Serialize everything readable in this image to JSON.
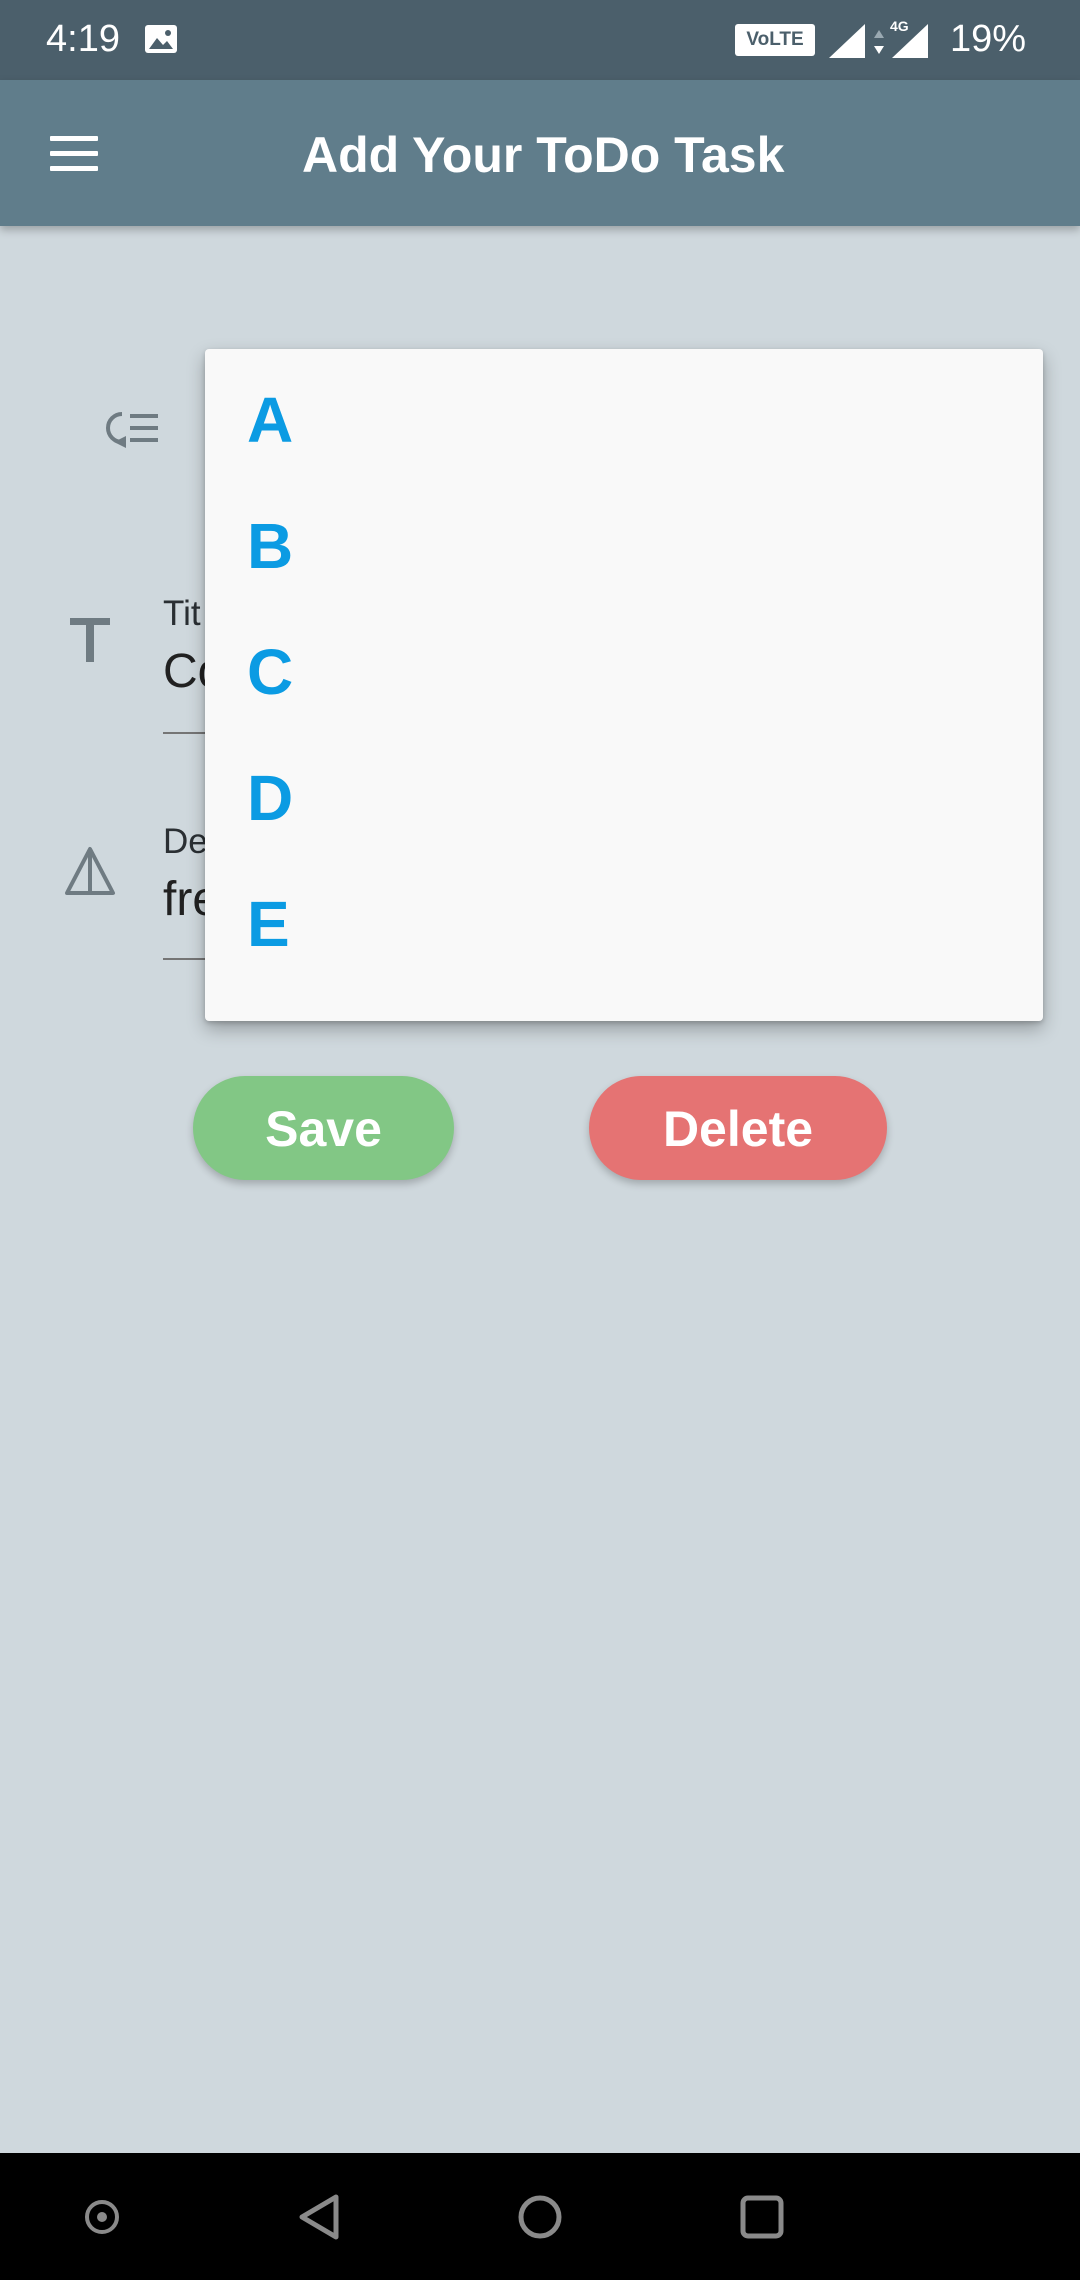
{
  "status_bar": {
    "time": "4:19",
    "volte": "VoLTE",
    "network": "4G",
    "battery": "19%",
    "icons": [
      "image-icon",
      "signal-icon",
      "data-arrows-icon",
      "signal-4g-icon"
    ]
  },
  "app_bar": {
    "menu_icon": "menu-icon",
    "title": "Add Your ToDo Task"
  },
  "form": {
    "priority_icon": "priority-icon",
    "title_field": {
      "icon": "text-title-icon",
      "label": "Tit",
      "value": "Co"
    },
    "description_field": {
      "icon": "description-icon",
      "label": "De",
      "value": "fre"
    }
  },
  "buttons": {
    "save": "Save",
    "delete": "Delete"
  },
  "dropdown": {
    "items": [
      "A",
      "B",
      "C",
      "D",
      "E"
    ]
  },
  "colors": {
    "status_bar": "#4b5f6b",
    "app_bar": "#607d8b",
    "background": "#cfd8dd",
    "save_button": "#82c785",
    "delete_button": "#e57373",
    "dropdown_text": "#0b9be3"
  },
  "nav_bar": {
    "icons": [
      "overview-dot-icon",
      "back-icon",
      "home-icon",
      "recents-icon"
    ]
  }
}
